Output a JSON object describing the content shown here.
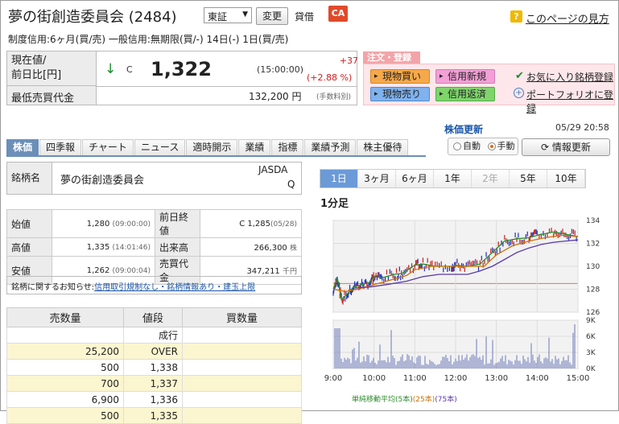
{
  "header": {
    "title": "夢の街創造委員会 (2484)",
    "market": "東証",
    "change_button": "変更",
    "taishaku": "貸借",
    "ca_badge": "CA",
    "help_link": "このページの見方",
    "help_icon_char": "?"
  },
  "credit_info": "制度信用:6ヶ月(買/売)  一般信用:無期限(買/-)  14日(-)  1日(買/売)",
  "price_box": {
    "label_line1": "現在値/",
    "label_line2": "前日比[円]",
    "arrow": "↓",
    "c_mark": "C",
    "price": "1,322",
    "time": "(15:00:00)",
    "change_abs": "+37",
    "change_pct": "(+2.88 %)",
    "min_label": "最低売買代金",
    "min_value": "132,200 円",
    "min_note": "(手数料別)"
  },
  "order_panel": {
    "tab_label": "注文・登録",
    "buy": "現物買い",
    "new_credit": "信用新規",
    "sell": "現物売り",
    "repay": "信用返済",
    "favorite": "お気に入り銘柄登録",
    "portfolio": "ポートフォリオに登録"
  },
  "tabs": [
    "株価",
    "四季報",
    "チャート",
    "ニュース",
    "適時開示",
    "業績",
    "指標",
    "業績予測",
    "株主優待"
  ],
  "update": {
    "title": "株価更新",
    "time": "05/29 20:58",
    "auto": "自動",
    "manual": "手動",
    "refresh": "情報更新"
  },
  "name_box": {
    "label": "銘柄名",
    "value": "夢の街創造委員会",
    "exchange_line1": "JASDA",
    "exchange_line2": "Q"
  },
  "ohlc": {
    "open_label": "始値",
    "open": "1,280",
    "open_time": "(09:00:00)",
    "high_label": "高値",
    "high": "1,335",
    "high_time": "(14:01:46)",
    "low_label": "安値",
    "low": "1,262",
    "low_time": "(09:00:04)",
    "prev_label": "前日終値",
    "prev": "C 1,285",
    "prev_date": "(05/28)",
    "volume_label": "出来高",
    "volume": "266,300",
    "volume_unit": "株",
    "turnover_label": "売買代金",
    "turnover": "347,211",
    "turnover_unit": "千円"
  },
  "notice": {
    "prefix": "銘柄に関するお知らせ:",
    "link": "信用取引規制なし・銘柄情報あり・建玉上限"
  },
  "board": {
    "headers": [
      "売数量",
      "値段",
      "買数量"
    ],
    "rows": [
      {
        "sell": "",
        "price": "成行",
        "buy": "",
        "style": "white"
      },
      {
        "sell": "25,200",
        "price": "OVER",
        "buy": "",
        "style": "ylw"
      },
      {
        "sell": "500",
        "price": "1,338",
        "buy": "",
        "style": "white"
      },
      {
        "sell": "700",
        "price": "1,337",
        "buy": "",
        "style": "ylw"
      },
      {
        "sell": "6,900",
        "price": "1,336",
        "buy": "",
        "style": "white"
      },
      {
        "sell": "500",
        "price": "1,335",
        "buy": "",
        "style": "ylw"
      }
    ]
  },
  "period_tabs": [
    {
      "label": "1日",
      "state": "active"
    },
    {
      "label": "3ヶ月",
      "state": "normal"
    },
    {
      "label": "6ヶ月",
      "state": "normal"
    },
    {
      "label": "1年",
      "state": "normal"
    },
    {
      "label": "2年",
      "state": "disabled"
    },
    {
      "label": "5年",
      "state": "normal"
    },
    {
      "label": "10年",
      "state": "normal"
    }
  ],
  "chart_heading": "1分足",
  "chart_data": {
    "type": "line",
    "x_ticks": [
      "9:00",
      "10:00",
      "11:00",
      "12:00",
      "13:00",
      "14:00",
      "15:00"
    ],
    "price_yticks": [
      1340,
      1320,
      1300,
      1280,
      1260
    ],
    "price_ylim": [
      1260,
      1340
    ],
    "volume_yticks": [
      "9K",
      "6K",
      "3K",
      "0K"
    ],
    "volume_ylim": [
      0,
      9000
    ],
    "prev_close": 1285,
    "series": [
      {
        "name": "5本",
        "color": "#2a8c2a",
        "x": [
          0,
          0.1,
          0.2,
          0.35,
          0.5,
          0.7,
          0.9,
          1.0,
          1.2,
          1.5,
          1.7,
          2.0,
          2.2,
          2.5,
          2.9,
          3.0,
          3.3,
          3.6,
          3.9,
          4.2,
          4.5,
          4.8,
          5.0,
          5.4,
          5.7,
          6.0
        ],
        "values": [
          1280,
          1290,
          1271,
          1276,
          1282,
          1284,
          1286,
          1291,
          1290,
          1293,
          1294,
          1301,
          1302,
          1300,
          1300,
          1301,
          1300,
          1302,
          1312,
          1322,
          1324,
          1325,
          1327,
          1330,
          1328,
          1326
        ]
      },
      {
        "name": "25本",
        "color": "#d07000",
        "x": [
          0,
          0.3,
          0.6,
          1.0,
          1.4,
          1.8,
          2.0,
          2.4,
          2.8,
          3.0,
          3.4,
          3.7,
          4.0,
          4.4,
          4.8,
          5.2,
          5.6,
          6.0
        ],
        "values": [
          1280,
          1278,
          1280,
          1284,
          1288,
          1292,
          1297,
          1300,
          1300,
          1300,
          1300,
          1300,
          1310,
          1318,
          1322,
          1325,
          1327,
          1326
        ]
      },
      {
        "name": "75本",
        "color": "#5a3aa8",
        "x": [
          0.5,
          0.9,
          1.3,
          1.8,
          2.2,
          2.6,
          3.0,
          3.3,
          3.6,
          3.9,
          4.2,
          4.5,
          4.8,
          5.1,
          5.4,
          5.7,
          6.0
        ],
        "values": [
          1281,
          1282,
          1284,
          1287,
          1291,
          1293,
          1293,
          1293,
          1296,
          1300,
          1306,
          1312,
          1316,
          1319,
          1321,
          1322,
          1323
        ]
      }
    ],
    "legend": {
      "label": "単純移動平均",
      "items": [
        "(5本)",
        "(25本)",
        "(75本)"
      ]
    }
  }
}
